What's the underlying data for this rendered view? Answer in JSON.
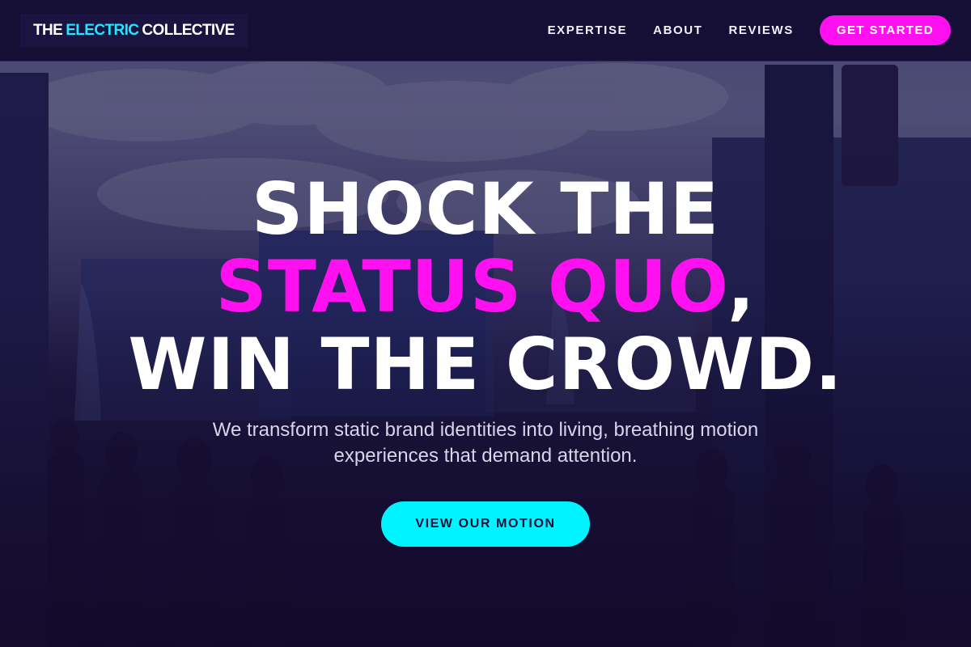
{
  "brand": {
    "logo_parts": [
      "THE",
      "ELECTRIC",
      "COLLECTIVE"
    ],
    "accent_color": "#22e6ff"
  },
  "nav": {
    "links": [
      "EXPERTISE",
      "ABOUT",
      "REVIEWS"
    ],
    "cta_label": "GET STARTED",
    "cta_color": "#ff10f0"
  },
  "hero": {
    "headline_line1": "SHOCK THE",
    "headline_line2_highlight": "STATUS QUO",
    "headline_line2_tail": ",",
    "headline_line3": "WIN THE CROWD.",
    "highlight_color": "#ff10f0",
    "subtext": "We transform static brand identities into living, breathing motion experiences that demand attention.",
    "cta_label": "VIEW OUR MOTION",
    "cta_color": "#00f4ff",
    "background_image": "crowd-at-outdoor-event-photo"
  }
}
